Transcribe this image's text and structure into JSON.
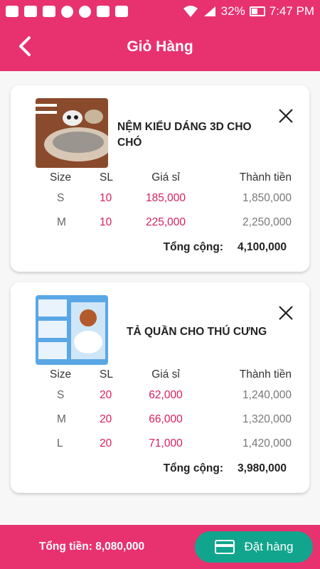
{
  "statusbar": {
    "battery": "32%",
    "time": "7:47 PM"
  },
  "appbar": {
    "title": "Giỏ Hàng"
  },
  "table_headers": {
    "size": "Size",
    "qty": "SL",
    "price": "Giá sỉ",
    "subtotal": "Thành tiền"
  },
  "total_label": "Tổng cộng:",
  "items": [
    {
      "name": "NỆM KIỂU DÁNG 3D CHO CHÓ",
      "rows": [
        {
          "size": "S",
          "qty": "10",
          "price": "185,000",
          "subtotal": "1,850,000"
        },
        {
          "size": "M",
          "qty": "10",
          "price": "225,000",
          "subtotal": "2,250,000"
        }
      ],
      "total": "4,100,000"
    },
    {
      "name": "TẢ QUẦN CHO THÚ CƯNG",
      "rows": [
        {
          "size": "S",
          "qty": "20",
          "price": "62,000",
          "subtotal": "1,240,000"
        },
        {
          "size": "M",
          "qty": "20",
          "price": "66,000",
          "subtotal": "1,320,000"
        },
        {
          "size": "L",
          "qty": "20",
          "price": "71,000",
          "subtotal": "1,420,000"
        }
      ],
      "total": "3,980,000"
    }
  ],
  "footer": {
    "grand_total": "Tổng tiền: 8,080,000",
    "order_button": "Đặt hàng"
  },
  "colors": {
    "primary": "#e8316f",
    "accent": "#12a58d",
    "price": "#d81e5b"
  },
  "icons": [
    "back-arrow-icon",
    "close-icon",
    "credit-card-icon"
  ]
}
